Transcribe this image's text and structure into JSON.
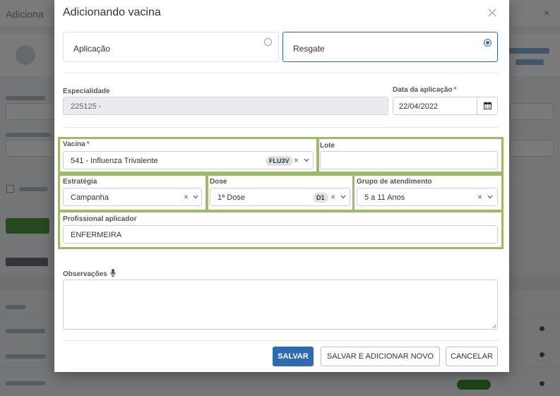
{
  "modal": {
    "title": "Adicionando vacina",
    "close_icon": "close-icon"
  },
  "tipo": {
    "options": [
      {
        "label": "Aplicação",
        "selected": false
      },
      {
        "label": "Resgate",
        "selected": true
      }
    ]
  },
  "especialidade": {
    "label": "Especialidade",
    "value": "225125 -"
  },
  "data_aplicacao": {
    "label": "Data da aplicação",
    "required": "*",
    "value": "22/04/2022",
    "icon": "calendar-icon"
  },
  "vacina": {
    "label": "Vacina",
    "required": "*",
    "value": "541 - Influenza Trivalente",
    "badge": "FLU3V"
  },
  "lote": {
    "label": "Lote",
    "value": ""
  },
  "estrategia": {
    "label": "Estratégia",
    "value": "Campanha"
  },
  "dose": {
    "label": "Dose",
    "value": "1ª Dose",
    "badge": "D1"
  },
  "grupo": {
    "label": "Grupo de atendimento",
    "value": "5 a 11 Anos"
  },
  "profissional": {
    "label": "Profissional aplicador",
    "value": "ENFERMEIRA"
  },
  "observacoes": {
    "label": "Observações",
    "icon": "microphone-icon"
  },
  "buttons": {
    "save": "SALVAR",
    "save_add": "SALVAR E ADICIONAR NOVO",
    "cancel": "CANCELAR"
  },
  "colors": {
    "primary": "#2d6ab0",
    "highlight": "#9fb96b",
    "required": "#d9534f"
  }
}
